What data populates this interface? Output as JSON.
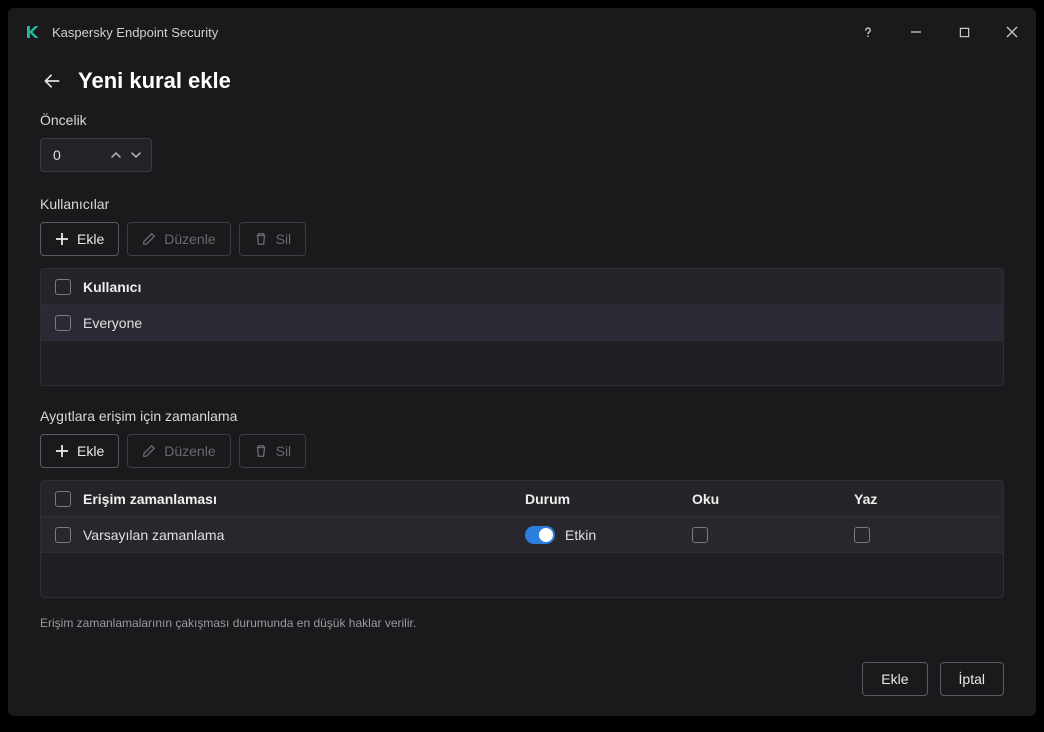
{
  "app": {
    "title": "Kaspersky Endpoint Security"
  },
  "page": {
    "title": "Yeni kural ekle"
  },
  "priority": {
    "label": "Öncelik",
    "value": "0"
  },
  "users": {
    "label": "Kullanıcılar",
    "toolbar": {
      "add": "Ekle",
      "edit": "Düzenle",
      "delete": "Sil"
    },
    "header": "Kullanıcı",
    "rows": [
      {
        "name": "Everyone"
      }
    ]
  },
  "schedule": {
    "label": "Aygıtlara erişim için zamanlama",
    "toolbar": {
      "add": "Ekle",
      "edit": "Düzenle",
      "delete": "Sil"
    },
    "headers": {
      "name": "Erişim zamanlaması",
      "status": "Durum",
      "read": "Oku",
      "write": "Yaz"
    },
    "rows": [
      {
        "name": "Varsayılan zamanlama",
        "status_label": "Etkin"
      }
    ]
  },
  "note": "Erişim zamanlamalarının çakışması durumunda en düşük haklar verilir.",
  "footer": {
    "add": "Ekle",
    "cancel": "İptal"
  }
}
